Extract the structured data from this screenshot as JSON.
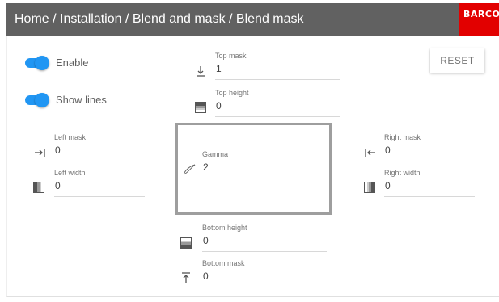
{
  "header": {
    "breadcrumb": "Home / Installation / Blend and mask / Blend mask",
    "logo_text": "BARCO",
    "colors": {
      "bar": "#616161",
      "logo_bg": "#e20000",
      "accent": "#2196f3"
    }
  },
  "toggles": {
    "enable": {
      "label": "Enable",
      "on": true
    },
    "show_lines": {
      "label": "Show lines",
      "on": true
    }
  },
  "reset_label": "RESET",
  "fields": {
    "top_mask": {
      "label": "Top mask",
      "value": "1",
      "icon": "arrow-down-to-line-icon"
    },
    "top_height": {
      "label": "Top height",
      "value": "0",
      "icon": "gradient-top-icon"
    },
    "left_mask": {
      "label": "Left mask",
      "value": "0",
      "icon": "arrow-right-to-line-icon"
    },
    "left_width": {
      "label": "Left width",
      "value": "0",
      "icon": "gradient-left-icon"
    },
    "gamma": {
      "label": "Gamma",
      "value": "2",
      "icon": "gamma-curve-icon"
    },
    "right_mask": {
      "label": "Right mask",
      "value": "0",
      "icon": "arrow-left-to-line-icon"
    },
    "right_width": {
      "label": "Right width",
      "value": "0",
      "icon": "gradient-right-icon"
    },
    "bottom_height": {
      "label": "Bottom height",
      "value": "0",
      "icon": "gradient-bottom-icon"
    },
    "bottom_mask": {
      "label": "Bottom mask",
      "value": "0",
      "icon": "arrow-up-to-line-icon"
    }
  }
}
